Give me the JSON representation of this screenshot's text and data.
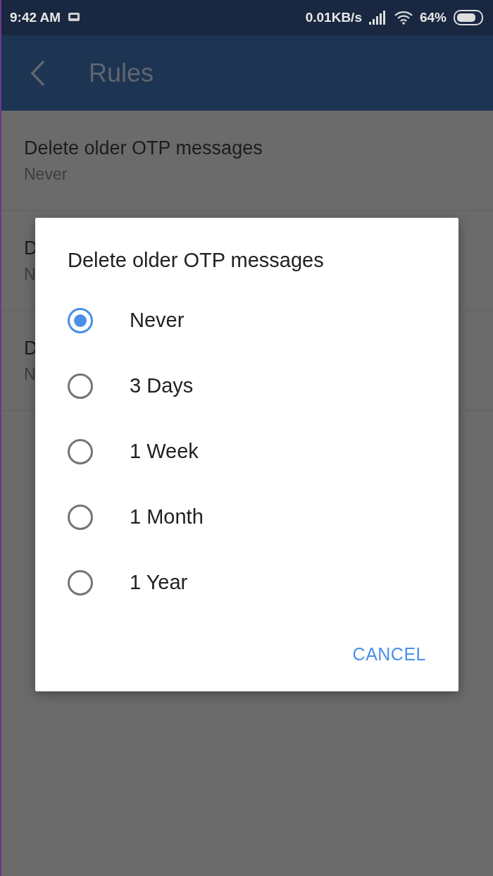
{
  "status_bar": {
    "time": "9:42 AM",
    "speed": "0.01KB/s",
    "battery": "64%"
  },
  "app_bar": {
    "title": "Rules"
  },
  "settings": [
    {
      "title": "Delete older OTP messages",
      "value": "Never"
    },
    {
      "title": "D",
      "value": "N"
    },
    {
      "title": "D",
      "value": "N"
    }
  ],
  "dialog": {
    "title": "Delete older OTP messages",
    "options": [
      {
        "label": "Never",
        "selected": true
      },
      {
        "label": "3 Days",
        "selected": false
      },
      {
        "label": "1 Week",
        "selected": false
      },
      {
        "label": "1 Month",
        "selected": false
      },
      {
        "label": "1 Year",
        "selected": false
      }
    ],
    "cancel": "CANCEL"
  }
}
